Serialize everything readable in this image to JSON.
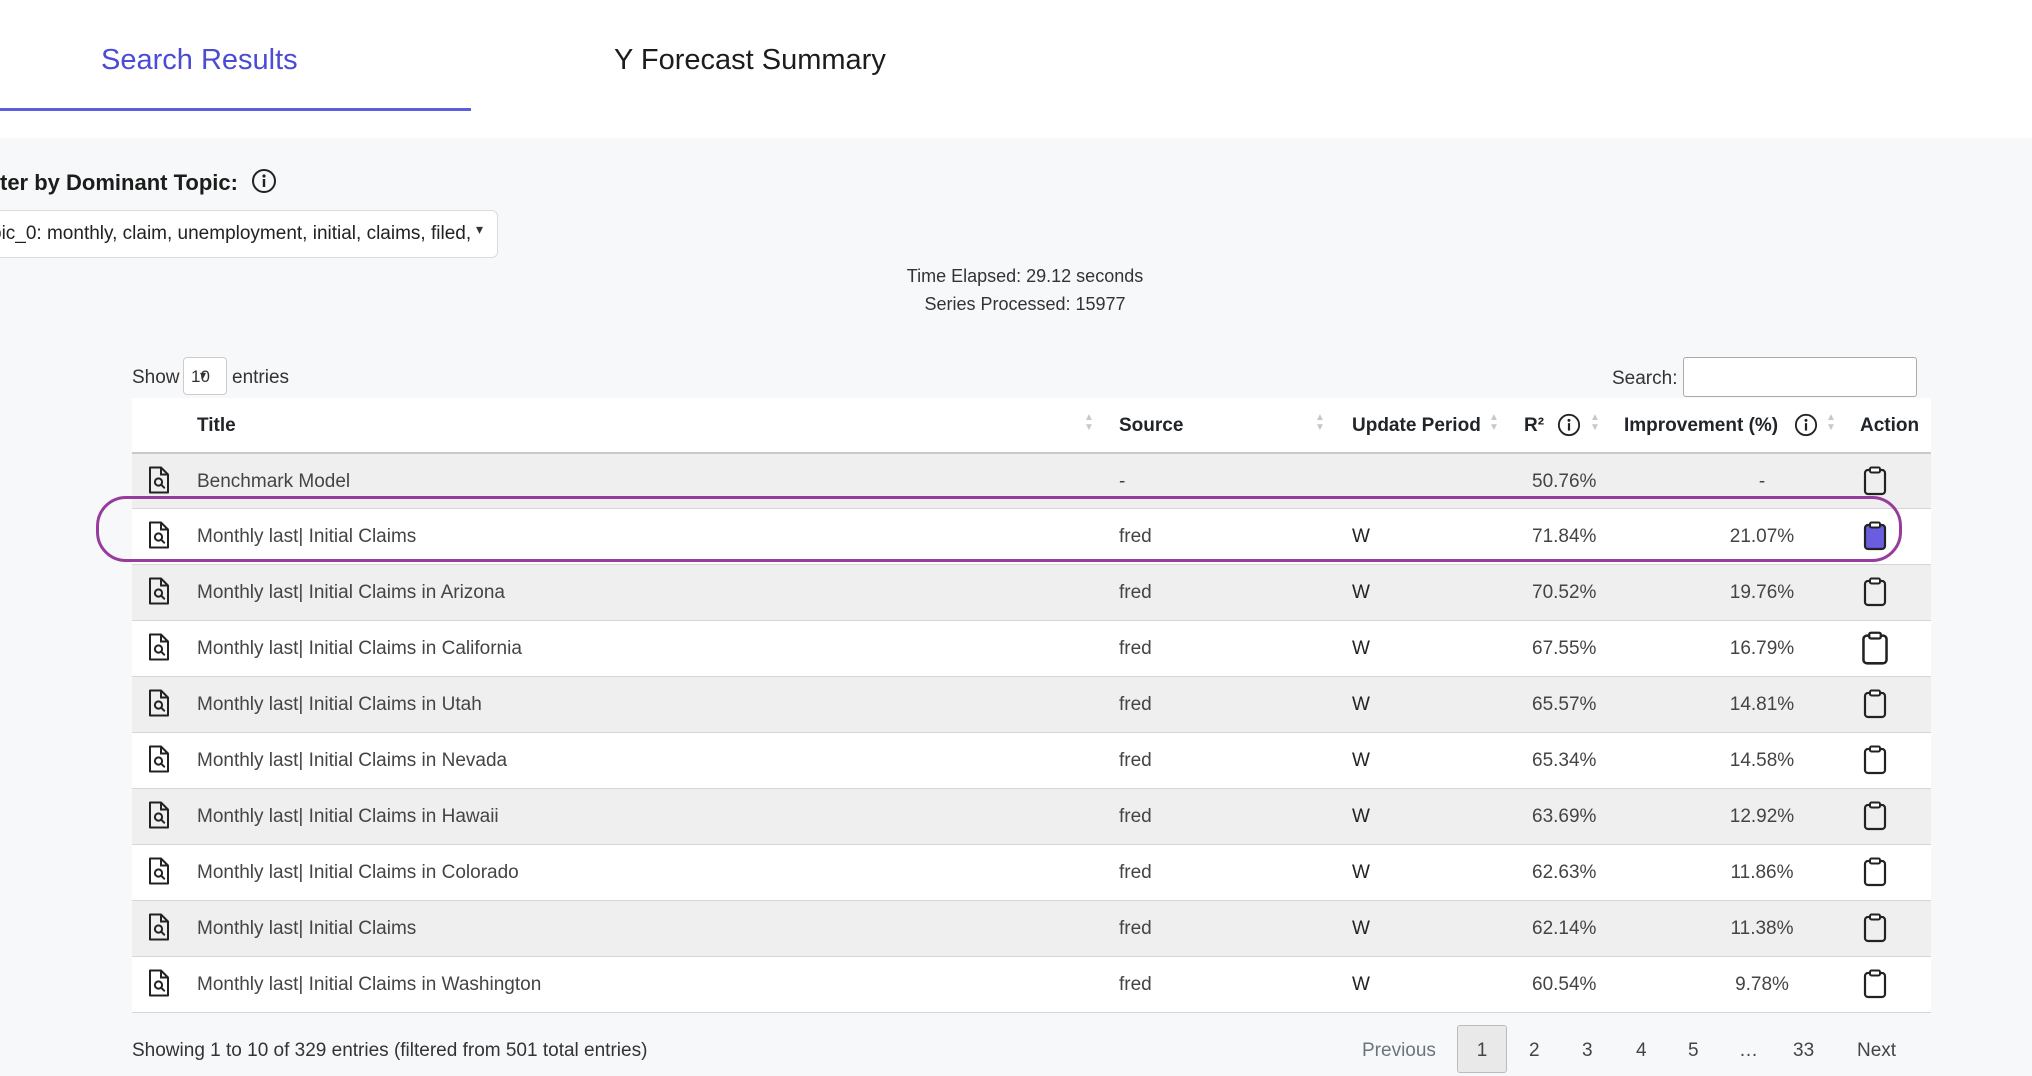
{
  "tabs": [
    {
      "label": "Search Results"
    },
    {
      "label": "Y Forecast Summary"
    }
  ],
  "filter": {
    "label": "ter by Dominant Topic:",
    "selected": "pic_0: monthly, claim, unemployment, initial, claims, filed,"
  },
  "stats": {
    "time_elapsed": "Time Elapsed: 29.12 seconds",
    "series_processed": "Series Processed: 15977"
  },
  "table_controls": {
    "show": "Show",
    "entries_value": "10",
    "entries": "entries",
    "search_label": "Search:",
    "search_value": ""
  },
  "columns": {
    "title": "Title",
    "source": "Source",
    "update_period": "Update Period",
    "r2": "R²",
    "improvement": "Improvement (%)",
    "action": "Action"
  },
  "rows": [
    {
      "title": "Benchmark Model",
      "source": "-",
      "period": "",
      "r2": "50.76%",
      "improvement": "-"
    },
    {
      "title": "Monthly last| Initial Claims",
      "source": "fred",
      "period": "W",
      "r2": "71.84%",
      "improvement": "21.07%"
    },
    {
      "title": "Monthly last| Initial Claims in Arizona",
      "source": "fred",
      "period": "W",
      "r2": "70.52%",
      "improvement": "19.76%"
    },
    {
      "title": "Monthly last| Initial Claims in California",
      "source": "fred",
      "period": "W",
      "r2": "67.55%",
      "improvement": "16.79%"
    },
    {
      "title": "Monthly last| Initial Claims in Utah",
      "source": "fred",
      "period": "W",
      "r2": "65.57%",
      "improvement": "14.81%"
    },
    {
      "title": "Monthly last| Initial Claims in Nevada",
      "source": "fred",
      "period": "W",
      "r2": "65.34%",
      "improvement": "14.58%"
    },
    {
      "title": "Monthly last| Initial Claims in Hawaii",
      "source": "fred",
      "period": "W",
      "r2": "63.69%",
      "improvement": "12.92%"
    },
    {
      "title": "Monthly last| Initial Claims in Colorado",
      "source": "fred",
      "period": "W",
      "r2": "62.63%",
      "improvement": "11.86%"
    },
    {
      "title": "Monthly last| Initial Claims",
      "source": "fred",
      "period": "W",
      "r2": "62.14%",
      "improvement": "11.38%"
    },
    {
      "title": "Monthly last| Initial Claims in Washington",
      "source": "fred",
      "period": "W",
      "r2": "60.54%",
      "improvement": "9.78%"
    }
  ],
  "footer": {
    "info": "Showing 1 to 10 of 329 entries (filtered from 501 total entries)",
    "previous": "Previous",
    "pages": [
      "1",
      "2",
      "3",
      "4",
      "5",
      "…",
      "33"
    ],
    "next": "Next"
  },
  "colors": {
    "accent": "#4b4bd6",
    "highlight_outline": "#973b9c",
    "active_clipboard_fill": "#6a5de0"
  },
  "icons": [
    "info-icon",
    "document-search-icon",
    "clipboard-icon",
    "clipboard-filled-icon"
  ]
}
